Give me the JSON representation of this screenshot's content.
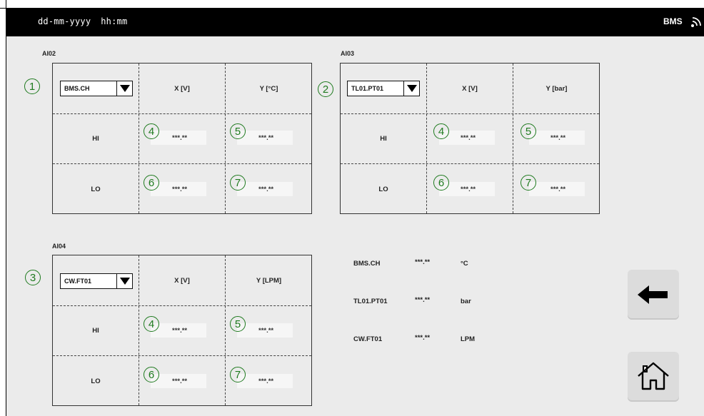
{
  "header": {
    "date": "dd-mm-yyyy",
    "time": "hh:mm",
    "brand": "BMS",
    "wifi_icon": "wifi-icon"
  },
  "panels": [
    {
      "label": "AI02",
      "marker": "1",
      "select_value": "BMS.CH",
      "x_header": "X [V]",
      "y_header": "Y [°C]",
      "rows": [
        {
          "name": "HI",
          "x_marker": "4",
          "x_value": "***.**",
          "y_marker": "5",
          "y_value": "***.**"
        },
        {
          "name": "LO",
          "x_marker": "6",
          "x_value": "***.**",
          "y_marker": "7",
          "y_value": "***.**"
        }
      ]
    },
    {
      "label": "AI03",
      "marker": "2",
      "select_value": "TL01.PT01",
      "x_header": "X [V]",
      "y_header": "Y [bar]",
      "rows": [
        {
          "name": "HI",
          "x_marker": "4",
          "x_value": "***.**",
          "y_marker": "5",
          "y_value": "***.**"
        },
        {
          "name": "LO",
          "x_marker": "6",
          "x_value": "***.**",
          "y_marker": "7",
          "y_value": "***.**"
        }
      ]
    },
    {
      "label": "AI04",
      "marker": "3",
      "select_value": "CW.FT01",
      "x_header": "X [V]",
      "y_header": "Y [LPM]",
      "rows": [
        {
          "name": "HI",
          "x_marker": "4",
          "x_value": "***.**",
          "y_marker": "5",
          "y_value": "***.**"
        },
        {
          "name": "LO",
          "x_marker": "6",
          "x_value": "***.**",
          "y_marker": "7",
          "y_value": "***.**"
        }
      ]
    }
  ],
  "live_values": [
    {
      "name": "BMS.CH",
      "value": "***.**",
      "unit": "°C"
    },
    {
      "name": "TL01.PT01",
      "value": "***.**",
      "unit": "bar"
    },
    {
      "name": "CW.FT01",
      "value": "***.**",
      "unit": "LPM"
    }
  ],
  "nav": {
    "back_icon": "arrow-left-icon",
    "home_icon": "home-icon"
  }
}
